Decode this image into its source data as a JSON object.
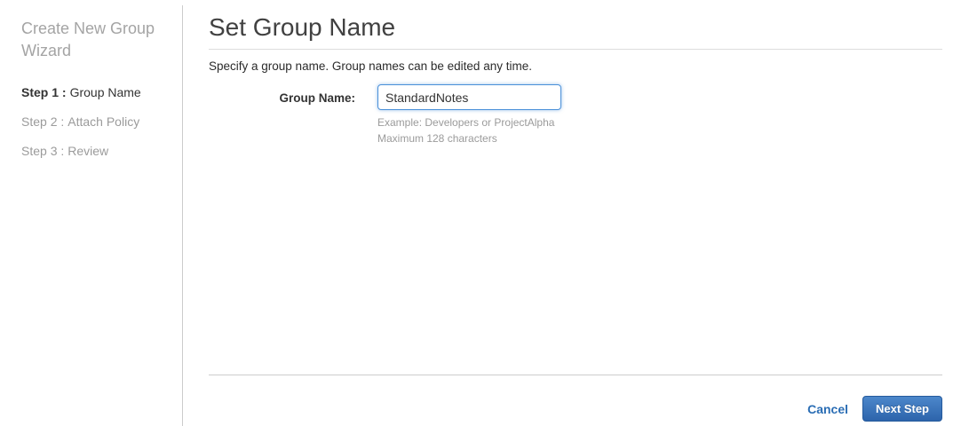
{
  "sidebar": {
    "title": "Create New Group Wizard",
    "steps": [
      {
        "prefix": "Step 1 :",
        "label": "Group Name",
        "active": true
      },
      {
        "prefix": "Step 2 :",
        "label": "Attach Policy",
        "active": false
      },
      {
        "prefix": "Step 3 :",
        "label": "Review",
        "active": false
      }
    ]
  },
  "main": {
    "title": "Set Group Name",
    "description": "Specify a group name. Group names can be edited any time.",
    "form": {
      "group_name_label": "Group Name:",
      "group_name_value": "StandardNotes",
      "hint_example": "Example: Developers or ProjectAlpha",
      "hint_max": "Maximum 128 characters"
    },
    "footer": {
      "cancel_label": "Cancel",
      "next_label": "Next Step"
    }
  },
  "colors": {
    "link_blue": "#2a6db4",
    "button_gradient_top": "#4c87cb",
    "button_gradient_bottom": "#2d64ab",
    "input_focus_border": "#4a90d9",
    "muted_text": "#9b9b9b",
    "divider": "#cccccc"
  }
}
